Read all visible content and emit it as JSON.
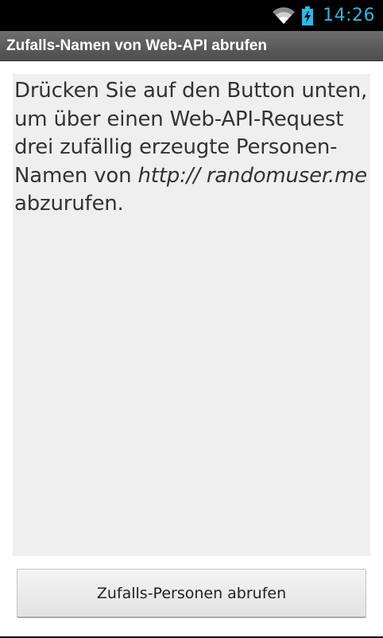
{
  "status_bar": {
    "time": "14:26",
    "wifi_icon": "wifi-icon",
    "battery_icon": "battery-charging-icon",
    "accent_color": "#33b5e5"
  },
  "action_bar": {
    "title": "Zufalls-Namen von Web-API abrufen"
  },
  "content": {
    "text_part1": "Drücken Sie auf den Button unten, um über einen Web-API-Request drei zufällig erzeugte Personen-Namen von ",
    "text_link": "http:// randomuser.me",
    "text_part2": " abzurufen."
  },
  "button": {
    "label": "Zufalls-Personen abrufen"
  }
}
